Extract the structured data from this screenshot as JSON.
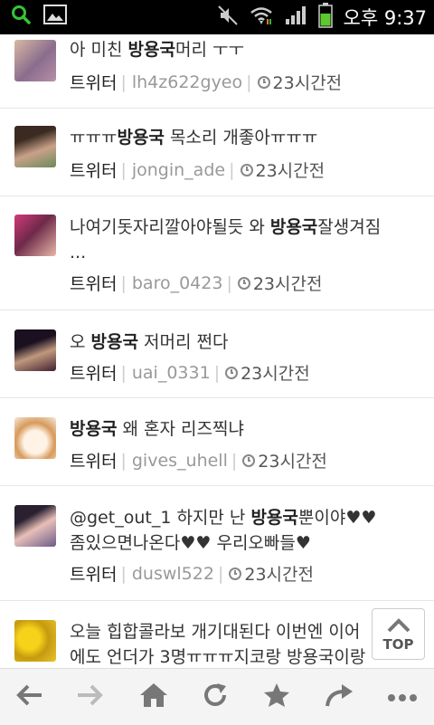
{
  "statusbar": {
    "time": "오후 9:37",
    "icons": [
      "search-icon",
      "gallery-icon",
      "mute-icon",
      "wifi-icon",
      "signal-icon",
      "battery-icon"
    ]
  },
  "feed": {
    "items": [
      {
        "pre": "아 미친 ",
        "highlight": "방용국",
        "post": "머리 ㅜㅜ",
        "line2": "",
        "source": "트위터",
        "user": "lh4z622gyeo",
        "time": "23시간전"
      },
      {
        "pre": "ㅠㅠㅠ",
        "highlight": "방용국",
        "post": " 목소리 개좋아ㅠㅠㅠ",
        "line2": "",
        "source": "트위터",
        "user": "jongin_ade",
        "time": "23시간전"
      },
      {
        "pre": "나여기돗자리깔아야될듯 와 ",
        "highlight": "방용국",
        "post": "잘생겨짐",
        "line2": "...",
        "source": "트위터",
        "user": "baro_0423",
        "time": "23시간전"
      },
      {
        "pre": "오 ",
        "highlight": "방용국",
        "post": " 저머리 쩐다",
        "line2": "",
        "source": "트위터",
        "user": "uai_0331",
        "time": "23시간전"
      },
      {
        "pre": "",
        "highlight": "방용국",
        "post": " 왜 혼자 리즈찍냐",
        "line2": "",
        "source": "트위터",
        "user": "gives_uhell",
        "time": "23시간전"
      },
      {
        "pre": "@get_out_1 하지만 난 ",
        "highlight": "방용국",
        "post": "뿐이야♥♥",
        "line2": "좀있으면나온다♥♥ 우리오빠들♥",
        "source": "트위터",
        "user": "duswl522",
        "time": "23시간전"
      },
      {
        "pre": "오늘 힙합콜라보 개기대된다 이번엔 이어",
        "highlight": "",
        "post": "",
        "line2": "에도 언더가 3명ㅠㅠㅠ지코랑 방용국이랑",
        "source": "",
        "user": "",
        "time": ""
      }
    ]
  },
  "top_button": {
    "label": "TOP"
  },
  "toolbar": {
    "buttons": [
      "back-icon",
      "forward-icon",
      "home-icon",
      "refresh-icon",
      "bookmark-star-icon",
      "share-icon",
      "more-icon"
    ]
  }
}
